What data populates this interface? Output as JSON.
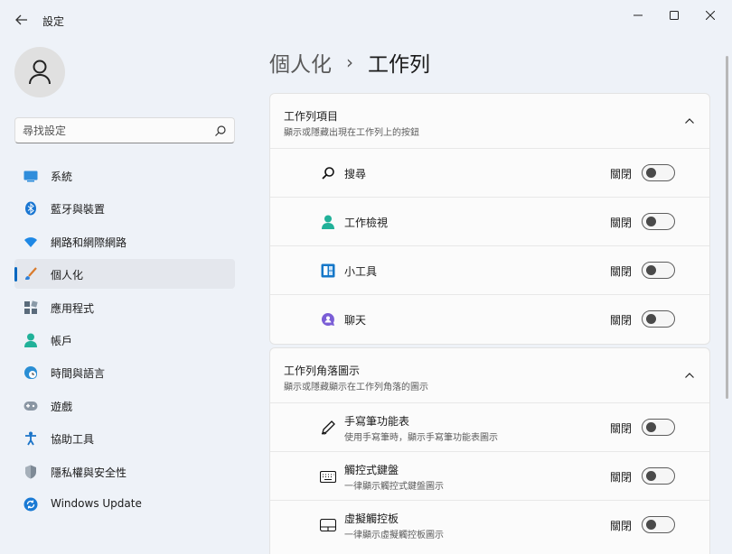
{
  "window": {
    "title": "設定"
  },
  "sidebar": {
    "search_placeholder": "尋找設定",
    "items": [
      {
        "label": "系統"
      },
      {
        "label": "藍牙與裝置"
      },
      {
        "label": "網路和網際網路"
      },
      {
        "label": "個人化",
        "active": true
      },
      {
        "label": "應用程式"
      },
      {
        "label": "帳戶"
      },
      {
        "label": "時間與語言"
      },
      {
        "label": "遊戲"
      },
      {
        "label": "協助工具"
      },
      {
        "label": "隱私權與安全性"
      },
      {
        "label": "Windows Update"
      }
    ]
  },
  "breadcrumb": {
    "parent": "個人化",
    "separator": "›",
    "current": "工作列"
  },
  "groups": [
    {
      "title": "工作列項目",
      "subtitle": "顯示或隱藏出現在工作列上的按鈕",
      "rows": [
        {
          "label": "搜尋",
          "state": "關閉"
        },
        {
          "label": "工作檢視",
          "state": "關閉"
        },
        {
          "label": "小工具",
          "state": "關閉"
        },
        {
          "label": "聊天",
          "state": "關閉"
        }
      ]
    },
    {
      "title": "工作列角落圖示",
      "subtitle": "顯示或隱藏顯示在工作列角落的圖示",
      "rows": [
        {
          "label": "手寫筆功能表",
          "sub": "使用手寫筆時，顯示手寫筆功能表圖示",
          "state": "關閉"
        },
        {
          "label": "觸控式鍵盤",
          "sub": "一律顯示觸控式鍵盤圖示",
          "state": "關閉"
        },
        {
          "label": "虛擬觸控板",
          "sub": "一律顯示虛擬觸控板圖示",
          "state": "關閉"
        }
      ]
    }
  ],
  "colors": {
    "accent": "#0067c0",
    "background": "#eef2f8",
    "card": "#fbfbfb"
  }
}
